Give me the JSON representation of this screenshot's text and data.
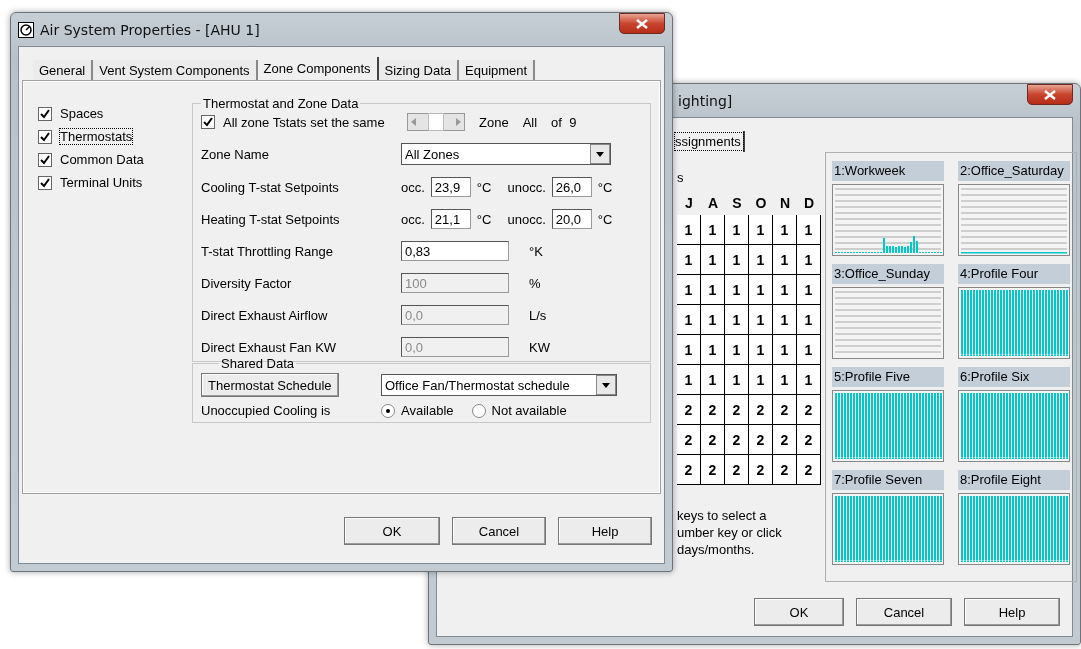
{
  "back_window": {
    "title": "ighting]",
    "tab": "ssignments",
    "column_heading": "s",
    "months": [
      "J",
      "A",
      "S",
      "O",
      "N",
      "D"
    ],
    "rows": [
      [
        "1",
        "1",
        "1",
        "1",
        "1",
        "1"
      ],
      [
        "1",
        "1",
        "1",
        "1",
        "1",
        "1"
      ],
      [
        "1",
        "1",
        "1",
        "1",
        "1",
        "1"
      ],
      [
        "1",
        "1",
        "1",
        "1",
        "1",
        "1"
      ],
      [
        "1",
        "1",
        "1",
        "1",
        "1",
        "1"
      ],
      [
        "1",
        "1",
        "1",
        "1",
        "1",
        "1"
      ],
      [
        "2",
        "2",
        "2",
        "2",
        "2",
        "2"
      ],
      [
        "2",
        "2",
        "2",
        "2",
        "2",
        "2"
      ],
      [
        "2",
        "2",
        "2",
        "2",
        "2",
        "2"
      ]
    ],
    "hint_lines": [
      "keys to select a",
      "umber key or click",
      "days/months."
    ],
    "profiles": [
      {
        "name": "1:Workweek",
        "kind": "peaks"
      },
      {
        "name": "2:Office_Saturday",
        "kind": "flat"
      },
      {
        "name": "3:Office_Sunday",
        "kind": "empty"
      },
      {
        "name": "4:Profile Four",
        "kind": "full"
      },
      {
        "name": "5:Profile Five",
        "kind": "full"
      },
      {
        "name": "6:Profile Six",
        "kind": "full"
      },
      {
        "name": "7:Profile Seven",
        "kind": "full"
      },
      {
        "name": "8:Profile Eight",
        "kind": "full"
      }
    ],
    "buttons": [
      "OK",
      "Cancel",
      "Help"
    ]
  },
  "front_window": {
    "title": "Air System Properties - [AHU 1]",
    "tabs": [
      {
        "label": "General",
        "selected": false
      },
      {
        "label": "Vent System Components",
        "selected": false
      },
      {
        "label": "Zone Components",
        "selected": true
      },
      {
        "label": "Sizing Data",
        "selected": false
      },
      {
        "label": "Equipment",
        "selected": false
      }
    ],
    "components": [
      {
        "label": "Spaces",
        "checked": true,
        "focused": false
      },
      {
        "label": "Thermostats",
        "checked": true,
        "focused": true
      },
      {
        "label": "Common Data",
        "checked": true,
        "focused": false
      },
      {
        "label": "Terminal Units",
        "checked": true,
        "focused": false
      }
    ],
    "thermostat_group": {
      "title": "Thermostat and Zone Data",
      "same_checkbox": {
        "label": "All zone Tstats set the same",
        "checked": true
      },
      "zone_spinner": {
        "label": "Zone",
        "value": "All",
        "count": "of  9"
      },
      "zone_name": {
        "label": "Zone Name",
        "value": "All Zones"
      },
      "setpoints": [
        {
          "label": "Cooling T-stat Setpoints",
          "occ_label": "occ.",
          "occ": "23,9",
          "occ_unit": "°C",
          "unocc_label": "unocc.",
          "unocc": "26,0",
          "unocc_unit": "°C"
        },
        {
          "label": "Heating T-stat Setpoints",
          "occ_label": "occ.",
          "occ": "21,1",
          "occ_unit": "°C",
          "unocc_label": "unocc.",
          "unocc": "20,0",
          "unocc_unit": "°C"
        }
      ],
      "fields": [
        {
          "label": "T-stat Throttling Range",
          "value": "0,83",
          "unit": "°K",
          "disabled": false
        },
        {
          "label": "Diversity Factor",
          "value": "100",
          "unit": "%",
          "disabled": true
        },
        {
          "label": "Direct Exhaust Airflow",
          "value": "0,0",
          "unit": "L/s",
          "disabled": true
        },
        {
          "label": "Direct Exhaust Fan KW",
          "value": "0,0",
          "unit": "KW",
          "disabled": true
        }
      ]
    },
    "shared_group": {
      "title": "Shared Data",
      "schedule_button": "Thermostat Schedule",
      "schedule_value": "Office Fan/Thermostat schedule",
      "unoccupied_label": "Unoccupied Cooling is",
      "options": [
        {
          "label": "Available",
          "selected": true
        },
        {
          "label": "Not available",
          "selected": false
        }
      ]
    },
    "buttons": [
      "OK",
      "Cancel",
      "Help"
    ]
  }
}
